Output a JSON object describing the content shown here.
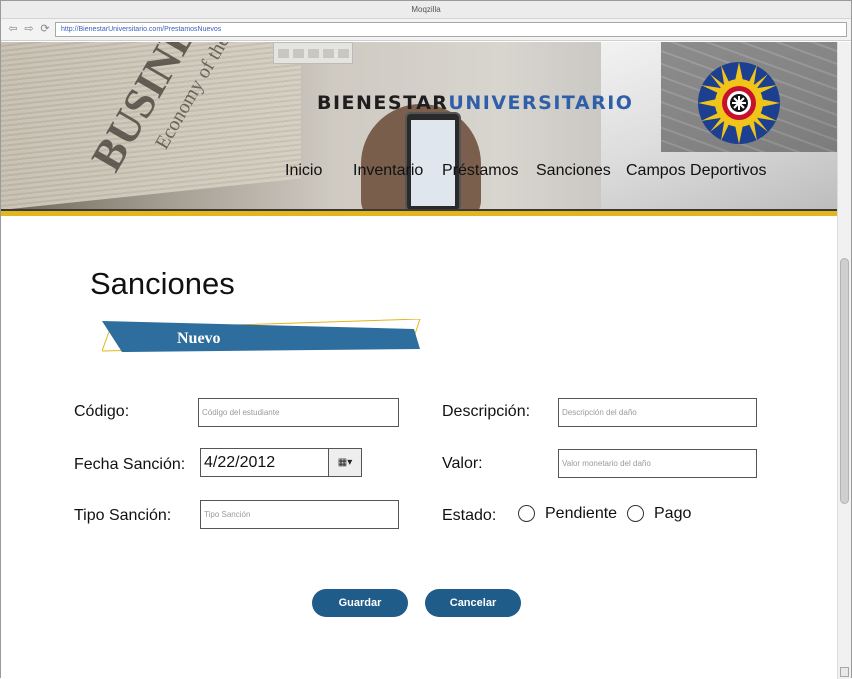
{
  "window": {
    "title": "Moqzilla",
    "url": "http://BienestarUniversitario.com/PrestamosNuevos"
  },
  "brand": {
    "part1": "BIENESTAR",
    "part2": "UNIVERSITARIO"
  },
  "banner": {
    "paper_word": "BUSINESS",
    "paper_head": "Economy of the European Union"
  },
  "nav": [
    "Inicio",
    "Inventario",
    "Préstamos",
    "Sanciones",
    "Campos Deportivos"
  ],
  "page": {
    "title": "Sanciones",
    "ribbon": "Nuevo"
  },
  "form": {
    "codigo": {
      "label": "Código:",
      "placeholder": "Código del estudiante"
    },
    "fecha": {
      "label": "Fecha Sanción:",
      "value": "4/22/2012"
    },
    "tipo": {
      "label": "Tipo Sanción:",
      "placeholder": "Tipo Sanción"
    },
    "descripcion": {
      "label": "Descripción:",
      "placeholder": "Descripción del daño"
    },
    "valor": {
      "label": "Valor:",
      "placeholder": "Valor monetario del daño"
    },
    "estado": {
      "label": "Estado:",
      "options": [
        "Pendiente",
        "Pago"
      ]
    }
  },
  "buttons": {
    "save": "Guardar",
    "cancel": "Cancelar"
  },
  "colors": {
    "accent": "#1f5c89",
    "stripe": "#e2b61c",
    "brand_blue": "#2f5fa8",
    "ribbon": "#2e6e9e"
  },
  "icons": [
    "back-icon",
    "forward-icon",
    "refresh-icon",
    "calendar-icon",
    "university-logo"
  ]
}
